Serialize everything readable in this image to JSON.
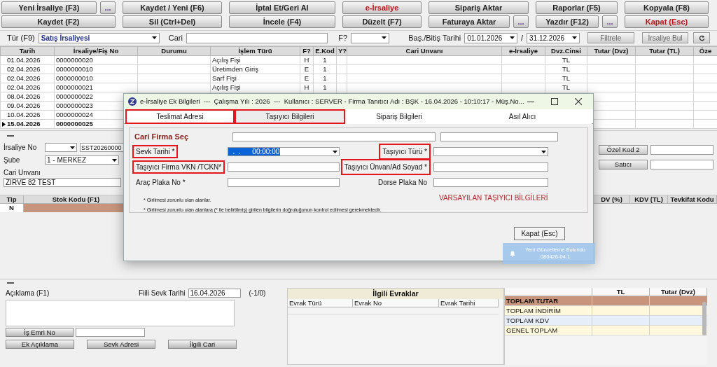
{
  "toolbar": {
    "rows": [
      [
        [
          {
            "label": "Yeni İrsaliye (F3)",
            "kind": "normal"
          },
          {
            "label": "...",
            "kind": "more"
          }
        ],
        [
          {
            "label": "Kaydet / Yeni (F6)",
            "kind": "normal"
          }
        ],
        [
          {
            "label": "İptal Et/Geri Al",
            "kind": "normal"
          }
        ],
        [
          {
            "label": "e-İrsaliye",
            "kind": "accent"
          }
        ],
        [
          {
            "label": "Sipariş Aktar",
            "kind": "normal"
          }
        ],
        [
          {
            "label": "Raporlar (F5)",
            "kind": "normal"
          }
        ],
        [
          {
            "label": "Kopyala (F8)",
            "kind": "normal"
          }
        ]
      ],
      [
        [
          {
            "label": "Kaydet (F2)",
            "kind": "normal"
          }
        ],
        [
          {
            "label": "Sil (Ctrl+Del)",
            "kind": "normal"
          }
        ],
        [
          {
            "label": "İncele (F4)",
            "kind": "normal"
          }
        ],
        [
          {
            "label": "Düzelt (F7)",
            "kind": "normal"
          }
        ],
        [
          {
            "label": "Faturaya Aktar",
            "kind": "normal"
          },
          {
            "label": "...",
            "kind": "more"
          }
        ],
        [
          {
            "label": "Yazdır (F12)",
            "kind": "normal"
          },
          {
            "label": "...",
            "kind": "more"
          }
        ],
        [
          {
            "label": "Kapat (Esc)",
            "kind": "accent"
          }
        ]
      ]
    ]
  },
  "filter": {
    "type_label": "Tür (F9)",
    "type_value": "Satış İrsaliyesi",
    "cari_label": "Cari",
    "f_label": "F?",
    "date_label": "Baş./Bitiş Tarihi",
    "start_date": "01.01.2026",
    "separator": "/",
    "end_date": "31.12.2026",
    "buttons": [
      "Filtrele",
      "İrsaliye Bul"
    ]
  },
  "table": {
    "columns": [
      "Tarih",
      "İrsaliye/Fiş No",
      "Durumu",
      "İşlem Türü",
      "F?",
      "E.Kod",
      "Y?",
      "Cari Unvanı",
      "e-İrsaliye",
      "Dvz.Cinsi",
      "Tutar (Dvz)",
      "Tutar (TL)",
      "Öze"
    ],
    "rows": [
      {
        "cells": [
          "01.04.2026",
          "0000000020",
          "",
          "Açılış Fişi",
          "H",
          "1",
          "",
          "",
          "",
          "TL",
          "",
          "",
          ""
        ],
        "selected": false
      },
      {
        "cells": [
          "02.04.2026",
          "0000000010",
          "",
          "Üretimden Giriş",
          "E",
          "1",
          "",
          "",
          "",
          "TL",
          "",
          "",
          ""
        ],
        "selected": false
      },
      {
        "cells": [
          "02.04.2026",
          "0000000010",
          "",
          "Sarf Fişi",
          "E",
          "1",
          "",
          "",
          "",
          "TL",
          "",
          "",
          ""
        ],
        "selected": false
      },
      {
        "cells": [
          "02.04.2026",
          "0000000021",
          "",
          "Açılış Fişi",
          "H",
          "1",
          "",
          "",
          "",
          "TL",
          "",
          "",
          ""
        ],
        "selected": false
      },
      {
        "cells": [
          "08.04.2026",
          "0000000022"
        ],
        "selected": false
      },
      {
        "cells": [
          "09.04.2026",
          "0000000023"
        ],
        "selected": false
      },
      {
        "cells": [
          "10.04.2026",
          "0000000024"
        ],
        "selected": false
      },
      {
        "cells": [
          "15.04.2026",
          "0000000025"
        ],
        "selected": true
      }
    ]
  },
  "form": {
    "irsaliye_no_label": "İrsaliye No",
    "irsaliye_no_value": "SST20260000",
    "sube_label": "Şube",
    "sube_value": "1 - MERKEZ",
    "cari_label": "Cari Unvanı",
    "cari_value": "ZIRVE 82 TEST",
    "right_buttons": [
      "Özel Kod 2",
      "Satıcı"
    ]
  },
  "items_table": {
    "left_columns": [
      "Tip",
      "Stok Kodu (F1)"
    ],
    "right_columns": [
      "DV (%)",
      "KDV (TL)",
      "Tevkifat Kodu"
    ],
    "row": {
      "tip": "N"
    }
  },
  "bottom": {
    "aciklama_label": "Açıklama (F1)",
    "fiili_label": "Fiili Sevk Tarihi",
    "fiili_value": "16.04.2026",
    "counter": "(-1/0)",
    "is_emri_button": "İş Emri No",
    "buttons": [
      "Ek Açıklama",
      "Sevk Adresi",
      "İlgili Cari"
    ],
    "documents": {
      "title": "İlgili Evraklar",
      "columns": [
        "Evrak Türü",
        "Evrak No",
        "Evrak Tarihi"
      ]
    },
    "totals": {
      "columns": [
        "TL",
        "Tutar (Dvz)"
      ],
      "rows": [
        {
          "label": "TOPLAM TUTAR",
          "color": "#c8957c"
        },
        {
          "label": "TOPLAM İNDİRİM",
          "color": "#fff8dc"
        },
        {
          "label": "TOPLAM KDV",
          "color": "#e6eefa"
        },
        {
          "label": "GENEL TOPLAM",
          "color": "#fff8dc"
        }
      ]
    }
  },
  "dialog": {
    "title": "e-İrsaliye Ek Bilgileri  ---  Çalışma Yılı : 2026  ---  Kullanıcı : SERVER - Firma Tanıtıcı Adı : BŞK - 16.04.2026 - 10:10:17 - Müş.No...",
    "tabs": [
      {
        "label": "Teslimat Adresi",
        "selected": false,
        "highlighted": true
      },
      {
        "label": "Taşıyıcı Bilgileri",
        "selected": true,
        "highlighted": true
      },
      {
        "label": "Sipariş Bilgileri",
        "selected": false,
        "highlighted": false
      },
      {
        "label": "Asıl Alıcı",
        "selected": false,
        "highlighted": false
      }
    ],
    "cari_label": "Cari Firma Seç",
    "rows": [
      {
        "left": {
          "label": "Sevk Tarihi *",
          "kind": "date",
          "value": "  .  .      00:00:00",
          "highlighted": true
        },
        "right": {
          "label": "Taşıyıcı Türü *",
          "kind": "select",
          "highlighted": true
        }
      },
      {
        "left": {
          "label": "Taşıyıcı Firma VKN /TCKN*",
          "kind": "text",
          "highlighted": true
        },
        "right": {
          "label": "Taşıyıcı Ünvan/Ad Soyad *",
          "kind": "text",
          "highlighted": true
        }
      },
      {
        "left": {
          "label": "Araç Plaka No *",
          "kind": "text",
          "highlighted": false
        },
        "right": {
          "label": "Dorse Plaka No",
          "kind": "text",
          "highlighted": false
        }
      }
    ],
    "notes": [
      "* Girilmesi zorunlu olan alanlar.",
      "* Girilmesi zorunlu olan alanlara (* ile belirtilmiş) girilen bilgilerin doğruluğunun kontrol edilmesi gerekmektedir."
    ],
    "default_label": "VARSAYILAN TAŞIYICI BİLGİLERİ",
    "close_button": "Kapat (Esc)"
  },
  "notification": {
    "title": "Yeni Güncelleme Bulundu",
    "code": "080426-04.1"
  }
}
